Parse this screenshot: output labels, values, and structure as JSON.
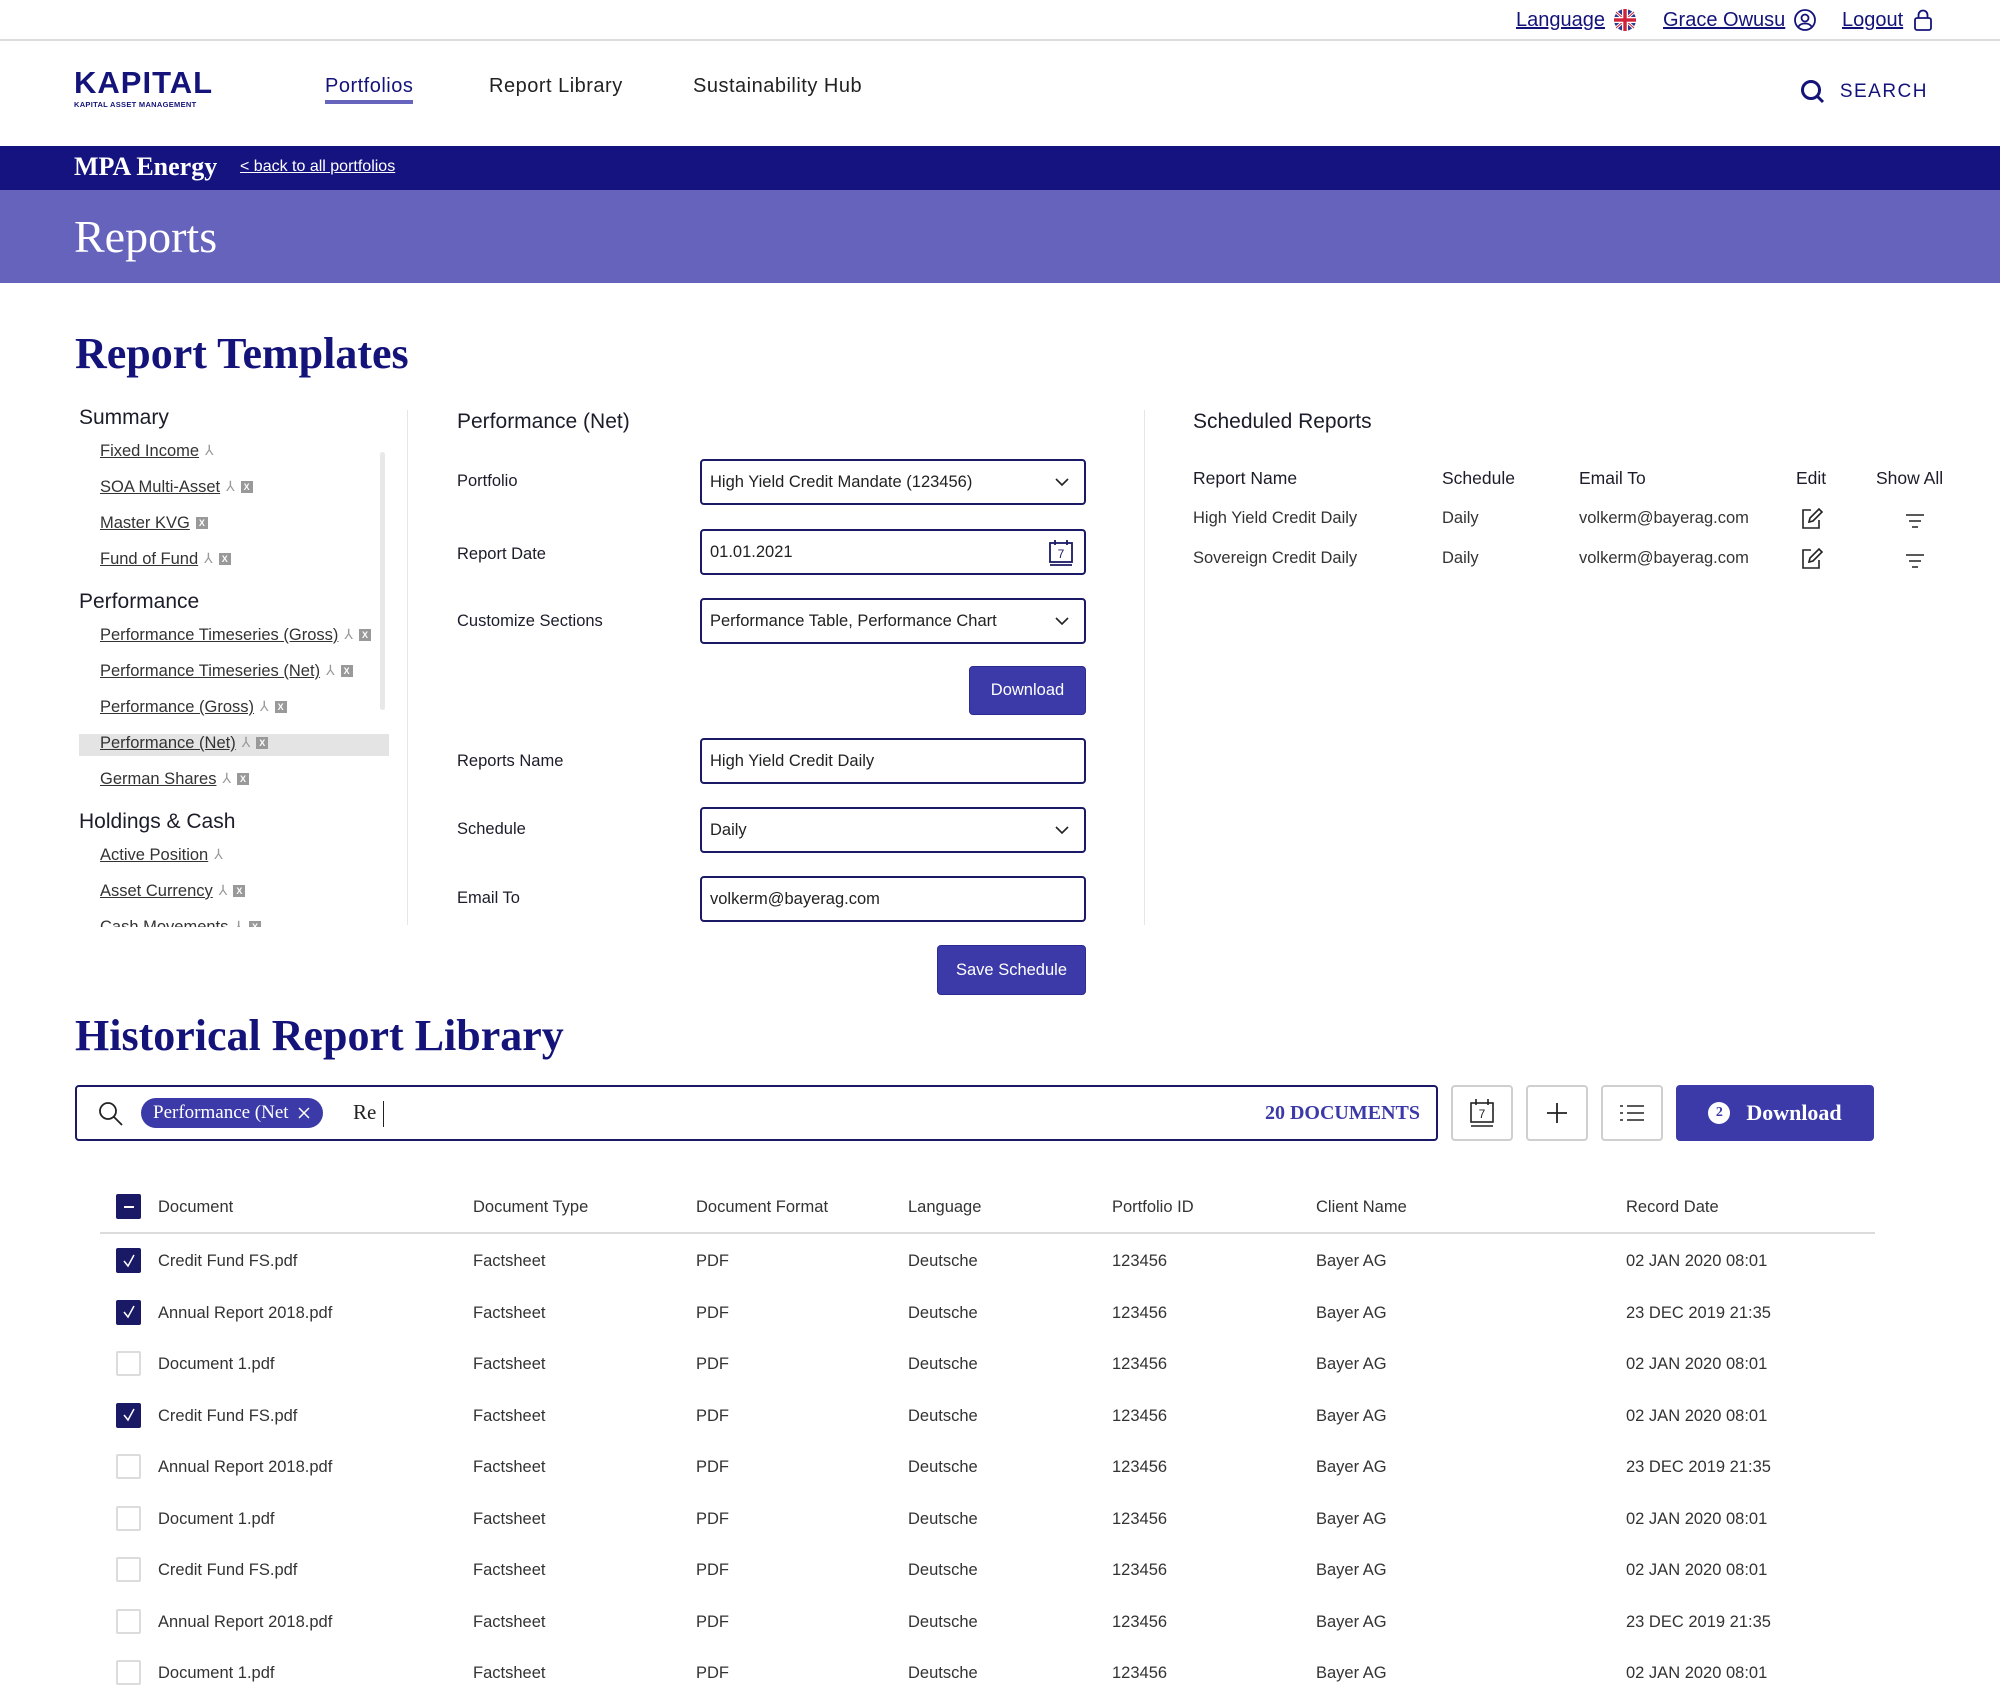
{
  "utility": {
    "language": "Language",
    "language_icon": "uk-flag-icon",
    "user": "Grace Owusu",
    "user_icon": "user-circle-icon",
    "logout": "Logout",
    "logout_icon": "lock-icon"
  },
  "nav": {
    "logo_main": "KAPITAL",
    "logo_sub": "KAPITAL ASSET MANAGEMENT",
    "links": [
      "Portfolios",
      "Report Library",
      "Sustainability Hub"
    ],
    "active": "Portfolios",
    "search": "SEARCH"
  },
  "portfolio_bar": {
    "title": "MPA Energy",
    "back": "< back to all portfolios"
  },
  "page_title": "Reports",
  "templates": {
    "heading": "Report Templates",
    "groups": [
      {
        "name": "Summary",
        "items": [
          {
            "label": "Fixed Income",
            "pdf": true,
            "xls": false
          },
          {
            "label": "SOA Multi-Asset",
            "pdf": true,
            "xls": true
          },
          {
            "label": "Master KVG",
            "pdf": false,
            "xls": true
          },
          {
            "label": "Fund of Fund",
            "pdf": true,
            "xls": true
          }
        ]
      },
      {
        "name": "Performance",
        "items": [
          {
            "label": "Performance Timeseries (Gross)",
            "pdf": true,
            "xls": true
          },
          {
            "label": "Performance Timeseries (Net)",
            "pdf": true,
            "xls": true
          },
          {
            "label": "Performance (Gross)",
            "pdf": true,
            "xls": true
          },
          {
            "label": "Performance (Net)",
            "pdf": true,
            "xls": true,
            "selected": true
          },
          {
            "label": "German Shares",
            "pdf": true,
            "xls": true
          }
        ]
      },
      {
        "name": "Holdings & Cash",
        "items": [
          {
            "label": "Active Position",
            "pdf": true,
            "xls": false
          },
          {
            "label": "Asset Currency",
            "pdf": true,
            "xls": true
          },
          {
            "label": "Cash Movements",
            "pdf": true,
            "xls": true
          }
        ]
      }
    ]
  },
  "form": {
    "title": "Performance (Net)",
    "portfolio_label": "Portfolio",
    "portfolio_value": "High Yield Credit Mandate (123456)",
    "report_date_label": "Report Date",
    "report_date_value": "01.01.2021",
    "sections_label": "Customize Sections",
    "sections_value": "Performance Table, Performance Chart",
    "download": "Download",
    "reports_name_label": "Reports Name",
    "reports_name_value": "High Yield Credit Daily",
    "schedule_label": "Schedule",
    "schedule_value": "Daily",
    "email_label": "Email To",
    "email_value": "volkerm@bayerag.com",
    "save_schedule": "Save Schedule"
  },
  "scheduled": {
    "title": "Scheduled Reports",
    "headers": [
      "Report Name",
      "Schedule",
      "Email To",
      "Edit",
      "Show All"
    ],
    "rows": [
      {
        "name": "High Yield Credit Daily",
        "schedule": "Daily",
        "email": "volkerm@bayerag.com"
      },
      {
        "name": "Sovereign Credit Daily",
        "schedule": "Daily",
        "email": "volkerm@bayerag.com"
      }
    ]
  },
  "library": {
    "heading": "Historical Report Library",
    "chip": "Performance (Net",
    "search_text": "Re",
    "doc_count": "20 DOCUMENTS",
    "download": "Download",
    "selected_count": "2",
    "headers": [
      "Document",
      "Document Type",
      "Document Format",
      "Language",
      "Portfolio ID",
      "Client Name",
      "Record Date"
    ],
    "rows": [
      {
        "checked": true,
        "doc": "Credit Fund FS.pdf",
        "type": "Factsheet",
        "format": "PDF",
        "lang": "Deutsche",
        "pid": "123456",
        "client": "Bayer AG",
        "date": "02 JAN 2020 08:01"
      },
      {
        "checked": true,
        "doc": "Annual Report 2018.pdf",
        "type": "Factsheet",
        "format": "PDF",
        "lang": "Deutsche",
        "pid": "123456",
        "client": "Bayer AG",
        "date": "23 DEC 2019 21:35"
      },
      {
        "checked": false,
        "doc": "Document 1.pdf",
        "type": "Factsheet",
        "format": "PDF",
        "lang": "Deutsche",
        "pid": "123456",
        "client": "Bayer AG",
        "date": "02 JAN 2020 08:01"
      },
      {
        "checked": true,
        "doc": "Credit Fund FS.pdf",
        "type": "Factsheet",
        "format": "PDF",
        "lang": "Deutsche",
        "pid": "123456",
        "client": "Bayer AG",
        "date": "02 JAN 2020 08:01"
      },
      {
        "checked": false,
        "doc": "Annual Report 2018.pdf",
        "type": "Factsheet",
        "format": "PDF",
        "lang": "Deutsche",
        "pid": "123456",
        "client": "Bayer AG",
        "date": "23 DEC 2019 21:35"
      },
      {
        "checked": false,
        "doc": "Document 1.pdf",
        "type": "Factsheet",
        "format": "PDF",
        "lang": "Deutsche",
        "pid": "123456",
        "client": "Bayer AG",
        "date": "02 JAN 2020 08:01"
      },
      {
        "checked": false,
        "doc": "Credit Fund FS.pdf",
        "type": "Factsheet",
        "format": "PDF",
        "lang": "Deutsche",
        "pid": "123456",
        "client": "Bayer AG",
        "date": "02 JAN 2020 08:01"
      },
      {
        "checked": false,
        "doc": "Annual Report 2018.pdf",
        "type": "Factsheet",
        "format": "PDF",
        "lang": "Deutsche",
        "pid": "123456",
        "client": "Bayer AG",
        "date": "23 DEC 2019 21:35"
      },
      {
        "checked": false,
        "doc": "Document 1.pdf",
        "type": "Factsheet",
        "format": "PDF",
        "lang": "Deutsche",
        "pid": "123456",
        "client": "Bayer AG",
        "date": "02 JAN 2020 08:01"
      }
    ]
  },
  "colors": {
    "navy": "#14137f",
    "accent": "#3b3aa8",
    "band": "#6663bd"
  }
}
